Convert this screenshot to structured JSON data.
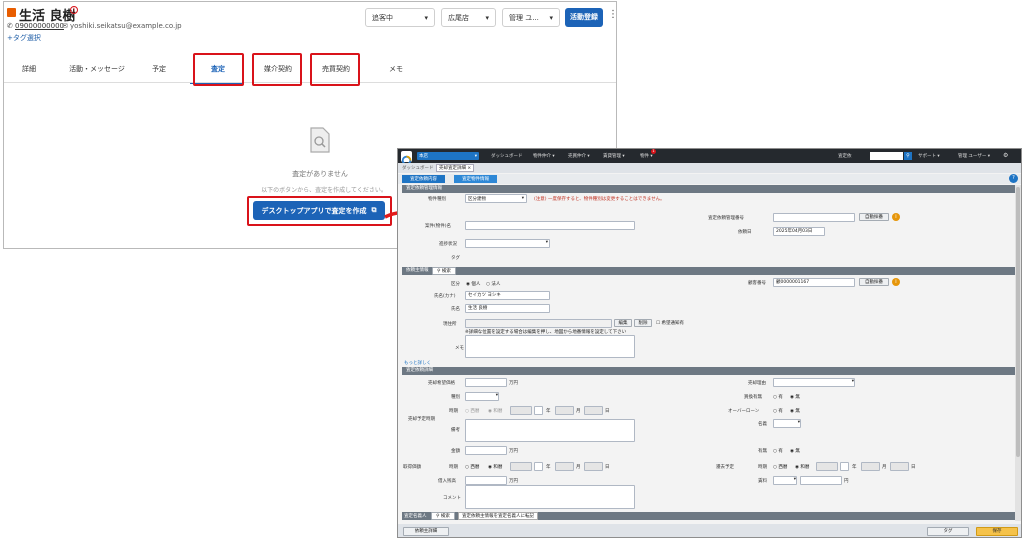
{
  "crm": {
    "name": "生活 良樹",
    "phone": "09000000000",
    "email": "yoshiki.seikatsu@example.co.jp",
    "tag_select": "+タグ選択",
    "status_select": "追客中",
    "store_select": "広尾店",
    "manager_select": "管理 ユ...",
    "activity_button": "活動登録",
    "tabs": [
      "詳細",
      "活動・メッセージ",
      "予定",
      "査定",
      "媒介契約",
      "売買契約",
      "メモ"
    ],
    "empty_title": "査定がありません",
    "empty_desc": "以下のボタンから、査定を作成してください。",
    "create_button": "デスクトップアプリで査定を作成"
  },
  "desktop": {
    "store": "本店",
    "nav": [
      "ダッシュボード",
      "物件仲介 ▾",
      "売買仲介 ▾",
      "賃貸管理 ▾",
      "物件 ▾"
    ],
    "nav_badge": "1",
    "search_select": "査定依",
    "support": "サポート ▾",
    "user": "管理 ユーザー ▾",
    "breadcrumb": [
      "ダッシュボード",
      "売却査定詳細 ×"
    ],
    "subtabs": [
      "査定依頼内容",
      "査定物件情報"
    ],
    "sec1": "査定依頼管理情報",
    "f_type": "物件種別",
    "f_type_val": "区分建物",
    "f_type_note": "(注意) 一度保存すると、物件種別は変更することはできません。",
    "f_name": "案件(物件)名",
    "f_no": "査定依頼管理番号",
    "f_auto": "自動採番",
    "f_date": "依頼日",
    "f_date_val": "2025年04月03日",
    "f_prog": "進捗状況",
    "f_tag": "タグ",
    "sec2": "依頼主情報",
    "search_btn": "検索",
    "f_kubun": "区分",
    "r_person": "個人",
    "r_corp": "法人",
    "f_cust": "顧客番号",
    "f_cust_val": "顧0000001167",
    "f_kana": "氏名(カナ)",
    "f_kana_val": "セイカツ ヨシキ",
    "f_shimei": "氏名",
    "f_shimei_val": "生活 良樹",
    "f_addr": "現住所",
    "edit_btn": "編集",
    "del_btn": "削除",
    "f_hope": "希望通知有",
    "addr_note": "※詳細な位置を設定する場合は編集を押し、地図から地番情報を設定して下さい",
    "f_memo": "メモ",
    "more": "もっと詳しく",
    "sec3": "査定依頼詳細",
    "l_price": "売却希望価格",
    "man": "万円",
    "l_reason": "売却理由",
    "l_kind": "種別",
    "l_kaikae": "買換有無",
    "r_yes": "有",
    "r_no": "無",
    "l_sale_time": "売却予定時期",
    "l_timing": "時期",
    "r_seireki": "西暦",
    "r_wareki": "和暦",
    "nen": "年",
    "gatsu": "月",
    "nichi": "日",
    "l_overloan": "オーバーローン",
    "l_meigi": "名義",
    "l_biko": "備考",
    "l_kingaku": "金額",
    "l_torikomi": "取得価額",
    "l_yuumu": "有無",
    "l_tsuika": "遷去予定",
    "l_iju": "借入残高",
    "l_chinryo": "賃料",
    "en": "円",
    "l_comment": "コメント",
    "bottom_tabs": [
      "査定名義人",
      "検索",
      "査定依頼主情報を査定名義人に転記"
    ],
    "footer_left": "依頼主詳細",
    "footer_tag": "タグ",
    "footer_save": "保存"
  }
}
